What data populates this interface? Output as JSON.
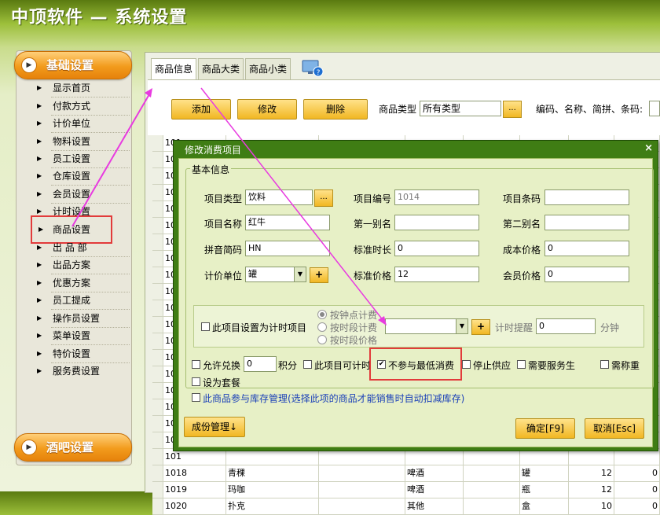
{
  "app": {
    "title": "中顶软件 — 系统设置"
  },
  "sidebar": {
    "section1": "基础设置",
    "section2": "酒吧设置",
    "items": [
      {
        "label": "显示首页"
      },
      {
        "label": "付款方式"
      },
      {
        "label": "计价单位"
      },
      {
        "label": "物料设置"
      },
      {
        "label": "员工设置"
      },
      {
        "label": "仓库设置"
      },
      {
        "label": "会员设置"
      },
      {
        "label": "计时设置"
      },
      {
        "label": "商品设置"
      },
      {
        "label": "出 品 部"
      },
      {
        "label": "出品方案"
      },
      {
        "label": "优惠方案"
      },
      {
        "label": "员工提成"
      },
      {
        "label": "操作员设置"
      },
      {
        "label": "菜单设置"
      },
      {
        "label": "特价设置"
      },
      {
        "label": "服务费设置"
      }
    ]
  },
  "tabs": [
    {
      "label": "商品信息"
    },
    {
      "label": "商品大类"
    },
    {
      "label": "商品小类"
    }
  ],
  "toolbar": {
    "add": "添加",
    "edit": "修改",
    "delete": "删除",
    "type_label": "商品类型",
    "type_value": "所有类型",
    "search_label": "编码、名称、简拼、条码:",
    "dots": "..."
  },
  "table": {
    "rows": [
      [
        "101",
        "",
        "",
        "",
        "",
        "",
        "",
        ""
      ],
      [
        "101",
        "",
        "",
        "",
        "",
        "",
        "",
        ""
      ],
      [
        "101",
        "",
        "",
        "",
        "",
        "",
        "",
        ""
      ],
      [
        "101",
        "",
        "",
        "",
        "",
        "",
        "",
        ""
      ],
      [
        "101",
        "",
        "",
        "",
        "",
        "",
        "",
        ""
      ],
      [
        "101",
        "",
        "",
        "",
        "",
        "",
        "",
        ""
      ],
      [
        "101",
        "",
        "",
        "",
        "",
        "",
        "",
        ""
      ],
      [
        "101",
        "",
        "",
        "",
        "",
        "",
        "",
        ""
      ],
      [
        "101",
        "",
        "",
        "",
        "",
        "",
        "",
        ""
      ],
      [
        "101",
        "",
        "",
        "",
        "",
        "",
        "",
        ""
      ],
      [
        "101",
        "",
        "",
        "",
        "",
        "",
        "",
        ""
      ],
      [
        "101",
        "",
        "",
        "",
        "",
        "",
        "",
        ""
      ],
      [
        "101",
        "",
        "",
        "",
        "",
        "",
        "",
        ""
      ],
      [
        "101",
        "",
        "",
        "",
        "",
        "",
        "",
        ""
      ],
      [
        "101",
        "",
        "",
        "",
        "",
        "",
        "",
        ""
      ],
      [
        "101",
        "",
        "",
        "",
        "",
        "",
        "",
        ""
      ],
      [
        "10",
        "",
        "",
        "",
        "",
        "",
        "",
        ""
      ],
      [
        "101",
        "",
        "",
        "",
        "",
        "",
        "",
        ""
      ],
      [
        "101",
        "",
        "",
        "",
        "",
        "",
        "",
        ""
      ],
      [
        "101",
        "",
        "",
        "",
        "",
        "",
        "",
        ""
      ],
      [
        "1018",
        "青稞",
        "",
        "啤酒",
        "",
        "罐",
        "12",
        "0"
      ],
      [
        "1019",
        "玛咖",
        "",
        "啤酒",
        "",
        "瓶",
        "12",
        "0"
      ],
      [
        "1020",
        "扑克",
        "",
        "其他",
        "",
        "盒",
        "10",
        "0"
      ]
    ]
  },
  "dialog": {
    "title": "修改消费项目",
    "close": "×",
    "group_title": "基本信息",
    "fields": {
      "type_label": "项目类型",
      "type_value": "饮料",
      "code_label": "项目编号",
      "code_value": "1014",
      "barcode_label": "项目条码",
      "barcode_value": "",
      "name_label": "项目名称",
      "name_value": "红牛",
      "alias1_label": "第一别名",
      "alias1_value": "",
      "alias2_label": "第二别名",
      "alias2_value": "",
      "pinyin_label": "拼音简码",
      "pinyin_value": "HN",
      "stdtime_label": "标准时长",
      "stdtime_value": "0",
      "cost_label": "成本价格",
      "cost_value": "0",
      "unit_label": "计价单位",
      "unit_value": "罐",
      "stdprice_label": "标准价格",
      "stdprice_value": "12",
      "member_label": "会员价格",
      "member_value": "0"
    },
    "timing": {
      "checkbox": "此项目设置为计时项目",
      "radio1": "按钟点计费",
      "radio2": "按时段计费",
      "radio3": "按时段价格",
      "reminder_label": "计时提醒",
      "reminder_value": "0",
      "minutes": "分钟"
    },
    "options": {
      "exchange": "允许兑换",
      "exchange_value": "0",
      "points": "积分",
      "timed": "此项目可计时",
      "min_consumption": "不参与最低消费",
      "stop_supply": "停止供应",
      "need_waiter": "需要服务生",
      "need_weigh": "需称重",
      "set_package": "设为套餐",
      "inventory": "此商品参与库存管理(选择此项的商品才能销售时自动扣减库存)"
    },
    "buttons": {
      "ingredients": "成份管理↓",
      "ok": "确定[F9]",
      "cancel": "取消[Esc]"
    }
  },
  "colors": {
    "accent": "#f29b1c",
    "dialog_header": "#3f7d14",
    "highlight": "#e23b3b",
    "arrow": "#e83be0"
  }
}
